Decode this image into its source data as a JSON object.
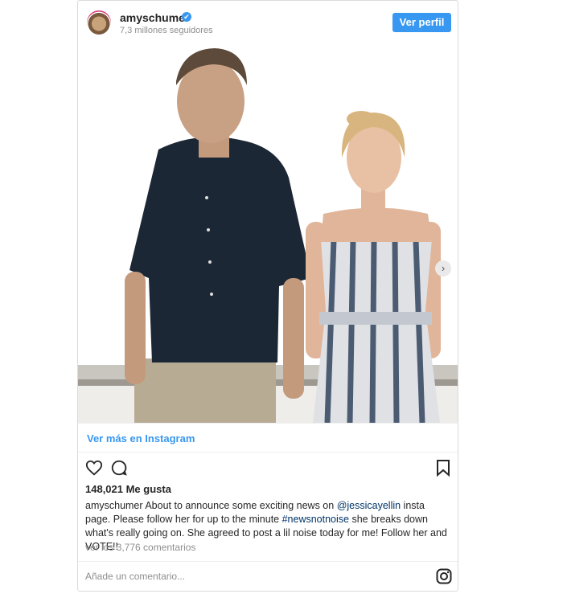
{
  "header": {
    "username": "amyschumer",
    "followers": "7,3 millones seguidores",
    "profile_button": "Ver perfil",
    "verified_icon": "✔"
  },
  "post": {
    "next_arrow": "›"
  },
  "footer": {
    "more_link": "Ver más en Instagram",
    "likes": "148,021 Me gusta",
    "caption_user": "amyschumer",
    "caption_part1": " About to announce some exciting news on ",
    "caption_mention": "@jessicayellin",
    "caption_part2": " insta page. Please follow her for up to the minute ",
    "caption_hashtag": "#newsnotnoise",
    "caption_part3": " she breaks down what's really going on. She agreed to post a lil noise today for me! Follow her and VOTE!!",
    "comments_link": "ver los 3,776 comentarios",
    "comment_placeholder": "Añade un comentario..."
  },
  "colors": {
    "accent": "#3897f0",
    "link": "#003569"
  }
}
